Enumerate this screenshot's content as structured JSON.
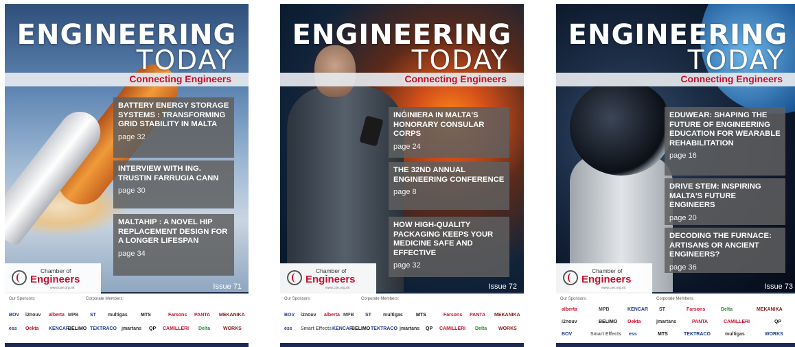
{
  "covers": [
    {
      "title_line1": "ENGINEERING",
      "title_line2": "TODAY",
      "tagline": "Connecting Engineers",
      "articles": [
        {
          "title": "BATTERY ENERGY STORAGE SYSTEMS : TRANSFORMING GRID STABILITY IN MALTA",
          "page": "page 32"
        },
        {
          "title": "INTERVIEW WITH ING. TRUSTIN FARRUGIA CANN",
          "page": "page 30"
        },
        {
          "title": "MALTAHIP : A NOVEL HIP REPLACEMENT DESIGN FOR A LONGER LIFESPAN",
          "page": "page 34"
        }
      ],
      "logo_small": "Chamber of",
      "logo_big": "Engineers",
      "logo_url": "www.coe.org.mt",
      "issue": "Issue 71",
      "sponsors_label": "Our Sponsors:",
      "members_label": "Corporate Members:",
      "sponsors_row1": [
        "BOV",
        "i2nouv",
        "alberta",
        "MPB",
        "ST",
        "multigas",
        "MTS",
        "Farsons",
        "PANTA",
        "MEKANIKA"
      ],
      "sponsors_row2": [
        "ess",
        "Oekta",
        "KENCAR",
        "BELIMO",
        "TEKTRACO",
        "jmartans",
        "QP",
        "CAMILLERI",
        "Delta",
        "WORKS"
      ]
    },
    {
      "title_line1": "ENGINEERING",
      "title_line2": "TODAY",
      "tagline": "Connecting Engineers",
      "articles": [
        {
          "title": "INĠINIERA IN MALTA'S HONORARY CONSULAR CORPS",
          "page": "page 24"
        },
        {
          "title": "THE 32ND ANNUAL ENGINEERING CONFERENCE",
          "page": "page 8"
        },
        {
          "title": "HOW HIGH-QUALITY PACKAGING KEEPS YOUR MEDICINE SAFE AND EFFECTIVE",
          "page": "page 32"
        }
      ],
      "logo_small": "Chamber of",
      "logo_big": "Engineers",
      "logo_url": "www.coe.org.mt",
      "issue": "Issue 72",
      "sponsors_label": "Our Sponsors:",
      "members_label": "Corporate Members:",
      "sponsors_row1": [
        "BOV",
        "i2nouv",
        "alberta",
        "MPB",
        "ST",
        "multigas",
        "MTS",
        "Farsons",
        "PANTA",
        "MEKANIKA"
      ],
      "sponsors_row2": [
        "ess",
        "Smart Effects",
        "KENCAR",
        "BELIMO",
        "TEKTRACO",
        "jmartans",
        "QP",
        "CAMILLERI",
        "Delta",
        "WORKS"
      ]
    },
    {
      "title_line1": "ENGINEERING",
      "title_line2": "TODAY",
      "tagline": "Connecting Engineers",
      "articles": [
        {
          "title": "EDUWEAR: SHAPING THE FUTURE OF ENGINEERING EDUCATION FOR WEARABLE REHABILITATION",
          "page": "page 16"
        },
        {
          "title": "DRIVE STEM: INSPIRING MALTA'S FUTURE ENGINEERS",
          "page": "page 20"
        },
        {
          "title": "DECODING THE FURNACE: ARTISANS OR ANCIENT ENGINEERS?",
          "page": "page 36"
        }
      ],
      "logo_small": "Chamber of",
      "logo_big": "Engineers",
      "logo_url": "www.coe.org.mt",
      "issue": "Issue 73",
      "sponsors_label": "Our Sponsors:",
      "members_label": "Corporate Members:",
      "sponsors_row1": [
        "alberta",
        "MPB",
        "KENCAR",
        "ST",
        "Farsons",
        "Delta",
        "MEKANIKA"
      ],
      "sponsors_row2": [
        "i2nouv",
        "BELIMO",
        "Oekta",
        "jmartans",
        "PANTA",
        "CAMILLERI",
        "QP"
      ],
      "sponsors_row3": [
        "BOV",
        "Smart Effects",
        "ess",
        "MTS",
        "TEKTRACO",
        "multigas",
        "WORKS"
      ]
    }
  ],
  "colors": {
    "accent_red": "#c8102e",
    "box_gray": "#5f5f5f",
    "strip_navy": "#1d2a55"
  }
}
